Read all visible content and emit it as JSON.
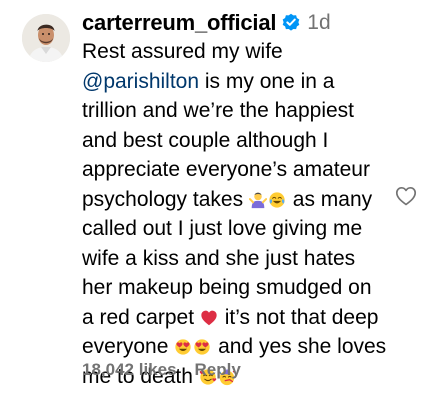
{
  "comment": {
    "avatar_icon": "avatar-photo",
    "username": "carterreum_official",
    "verified_icon": "verified-badge-icon",
    "timestamp": "1d",
    "mention": "@parishilton",
    "text_lines": [
      "Rest assured my wife",
      " is my one in a",
      "trillion and we’re the happiest",
      "and best couple although I",
      "appreciate everyone’s amateur",
      "psychology takes ",
      " as many",
      "called out I just love giving me",
      "wife a kiss and she just hates",
      "her makeup being smudged on",
      "a red carpet ",
      " it’s not that deep",
      "everyone ",
      " and yes she loves",
      "me to death "
    ],
    "likes": "18,042 likes",
    "reply_label": "Reply",
    "like_icon": "heart-outline-icon",
    "emojis": [
      "person-shrugging-emoji",
      "face-with-tears-of-joy-emoji",
      "red-heart-emoji",
      "heart-eyes-emoji",
      "smiling-face-with-hearts-emoji",
      "partying-face-emoji"
    ],
    "colors": {
      "verified_blue": "#0095f6",
      "mention_blue": "#00376b",
      "secondary_gray": "#737373",
      "heart_red": "#e0245e",
      "emoji_yellow": "#ffcc33"
    }
  }
}
